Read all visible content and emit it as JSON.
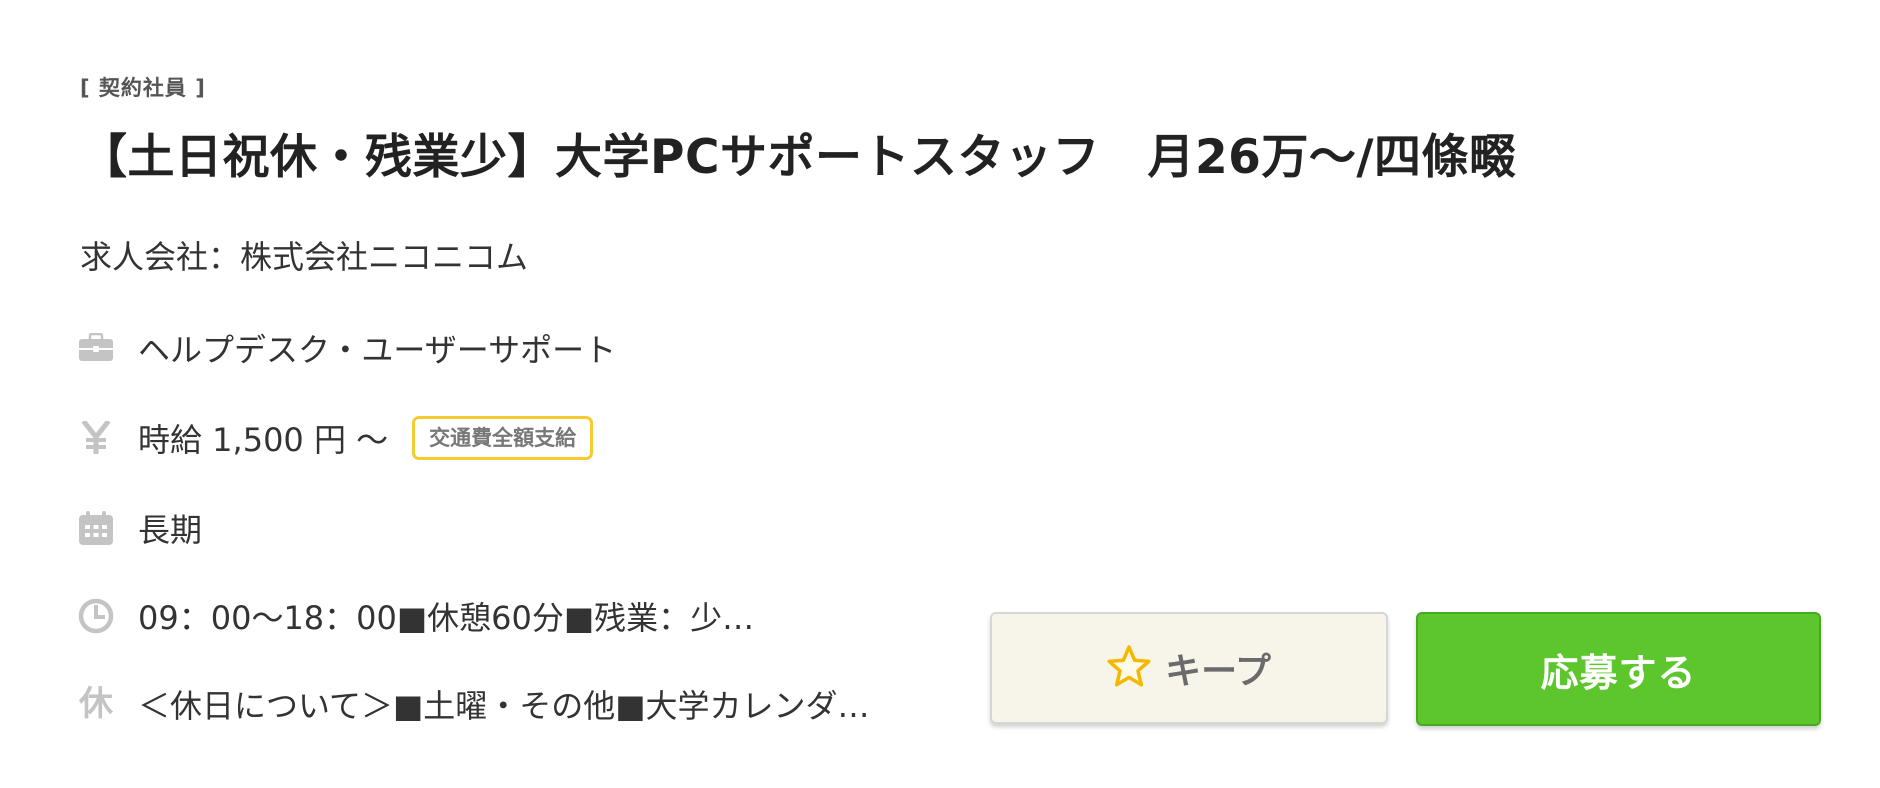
{
  "job": {
    "employment_type": "[ 契約社員 ]",
    "title": "【土日祝休・残業少】大学PCサポートスタッフ　月26万〜/四條畷",
    "company": "求人会社：株式会社ニコニコム",
    "category": {
      "icon": "briefcase-icon",
      "text": "ヘルプデスク・ユーザーサポート"
    },
    "salary": {
      "icon": "yen-icon",
      "text": "時給 1,500 円 〜",
      "badge": "交通費全額支給"
    },
    "duration": {
      "icon": "calendar-icon",
      "text": "長期"
    },
    "hours": {
      "icon": "clock-icon",
      "text": "09：00〜18：00■休憩60分■残業：少…"
    },
    "holidays": {
      "icon": "holiday-icon",
      "icon_glyph": "休",
      "text": "＜休日について＞■土曜・その他■大学カレンダ…"
    }
  },
  "actions": {
    "keep_label": "キープ",
    "apply_label": "応募する"
  },
  "colors": {
    "icon_gray": "#c4c4c4",
    "badge_border": "#f5cc2f",
    "keep_bg": "#f7f5ea",
    "star": "#f5b800",
    "apply_bg": "#5dc62d"
  }
}
